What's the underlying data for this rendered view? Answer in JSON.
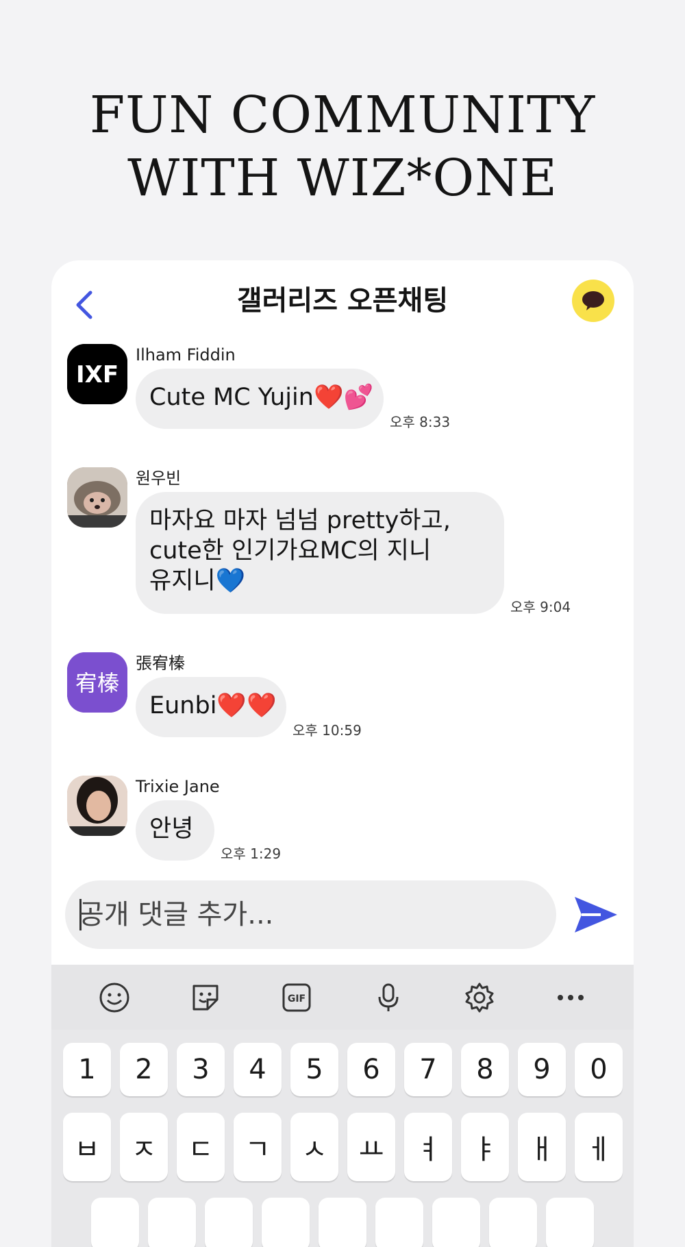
{
  "headline": {
    "line1": "FUN COMMUNITY",
    "line2": "WITH WIZ*ONE"
  },
  "chat": {
    "title": "갤러리즈 오픈채팅",
    "messages": [
      {
        "sender": "Ilham Fiddin",
        "lines": [
          "Cute MC Yujin❤️💕"
        ],
        "time": "오후 8:33",
        "avatar_text": "IXF"
      },
      {
        "sender": "원우빈",
        "lines": [
          "마자요 마자 넘넘 pretty하고,",
          "cute한 인기가요MC의 지니",
          "유지니💙"
        ],
        "time": "오후 9:04"
      },
      {
        "sender": "張宥榛",
        "lines": [
          "Eunbi❤️❤️"
        ],
        "time": "오후 10:59",
        "avatar_text": "宥榛"
      },
      {
        "sender": "Trixie Jane",
        "lines": [
          "안녕"
        ],
        "time": "오후 1:29"
      }
    ],
    "input_placeholder": "공개 댓글 추가..."
  },
  "keyboard": {
    "toolbar": [
      "emoji-icon",
      "sticker-icon",
      "gif-icon",
      "microphone-icon",
      "settings-icon",
      "more-icon"
    ],
    "gif_label": "GIF",
    "number_row": [
      "1",
      "2",
      "3",
      "4",
      "5",
      "6",
      "7",
      "8",
      "9",
      "0"
    ],
    "letter_row": [
      "ㅂ",
      "ㅈ",
      "ㄷ",
      "ㄱ",
      "ㅅ",
      "ㅛ",
      "ㅕ",
      "ㅑ",
      "ㅐ",
      "ㅔ"
    ]
  },
  "colors": {
    "accent": "#4356e0",
    "kakao_yellow": "#f9e14a",
    "bubble": "#eeeeef",
    "avatar_purple": "#7b4fcf"
  }
}
